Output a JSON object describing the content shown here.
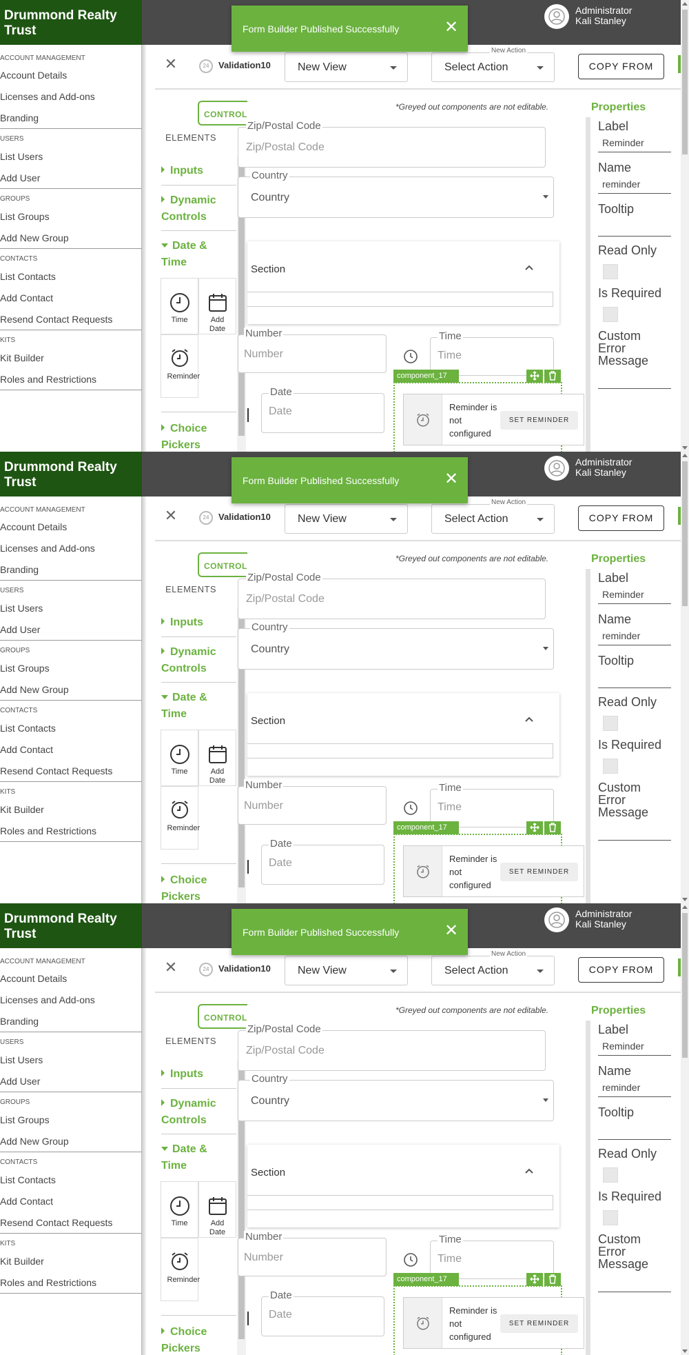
{
  "brand": {
    "name": "Drummond Realty Trust"
  },
  "user": {
    "role": "Administrator",
    "name": "Kali Stanley"
  },
  "toast": {
    "message": "Form Builder Published Successfully",
    "close": "✕"
  },
  "nav": {
    "sections": [
      {
        "header": "ACCOUNT MANAGEMENT",
        "items": [
          "Account Details",
          "Licenses and Add-ons",
          "Branding"
        ]
      },
      {
        "header": "USERS",
        "items": [
          "List Users",
          "Add User"
        ]
      },
      {
        "header": "GROUPS",
        "items": [
          "List Groups",
          "Add New Group"
        ]
      },
      {
        "header": "CONTACTS",
        "items": [
          "List Contacts",
          "Add Contact",
          "Resend Contact Requests"
        ]
      },
      {
        "header": "KITS",
        "items": [
          "Kit Builder",
          "Roles and Restrictions"
        ]
      }
    ]
  },
  "toolbar": {
    "close": "✕",
    "version_badge": "24",
    "form_name": "Validation10",
    "view_select": "New View",
    "action_legend": "New Action",
    "action_select": "Select Action",
    "copy_from": "COPY FROM"
  },
  "controls": {
    "tab": "CONTROLS",
    "elements_label": "ELEMENTS",
    "categories": {
      "inputs": "Inputs",
      "dynamic": "Dynamic Controls",
      "datetime": "Date & Time",
      "choice": "Choice Pickers"
    },
    "tiles": {
      "time": "Time",
      "add_date": "Add Date",
      "reminder": "Reminder"
    }
  },
  "canvas": {
    "hint": "*Greyed out components are not editable.",
    "zip_label": "Zip/Postal Code",
    "zip_placeholder": "Zip/Postal Code",
    "country_label": "Country",
    "country_value": "Country",
    "section_title": "Section",
    "number_label": "Number",
    "number_placeholder": "Number",
    "time_label": "Time",
    "time_placeholder": "Time",
    "date_label": "Date",
    "date_placeholder": "Date",
    "component_tag": "component_17",
    "reminder_msg": "Reminder is not configured",
    "set_reminder": "SET REMINDER"
  },
  "properties": {
    "title": "Properties",
    "label_label": "Label",
    "label_value": "Reminder",
    "name_label": "Name",
    "name_value": "reminder",
    "tooltip_label": "Tooltip",
    "tooltip_value": "",
    "read_only_label": "Read Only",
    "is_required_label": "Is Required",
    "custom_error_label": "Custom Error Message"
  },
  "colors": {
    "brand_green": "#1e5512",
    "accent_green": "#6bb23f",
    "topbar": "#4a4a4a"
  }
}
